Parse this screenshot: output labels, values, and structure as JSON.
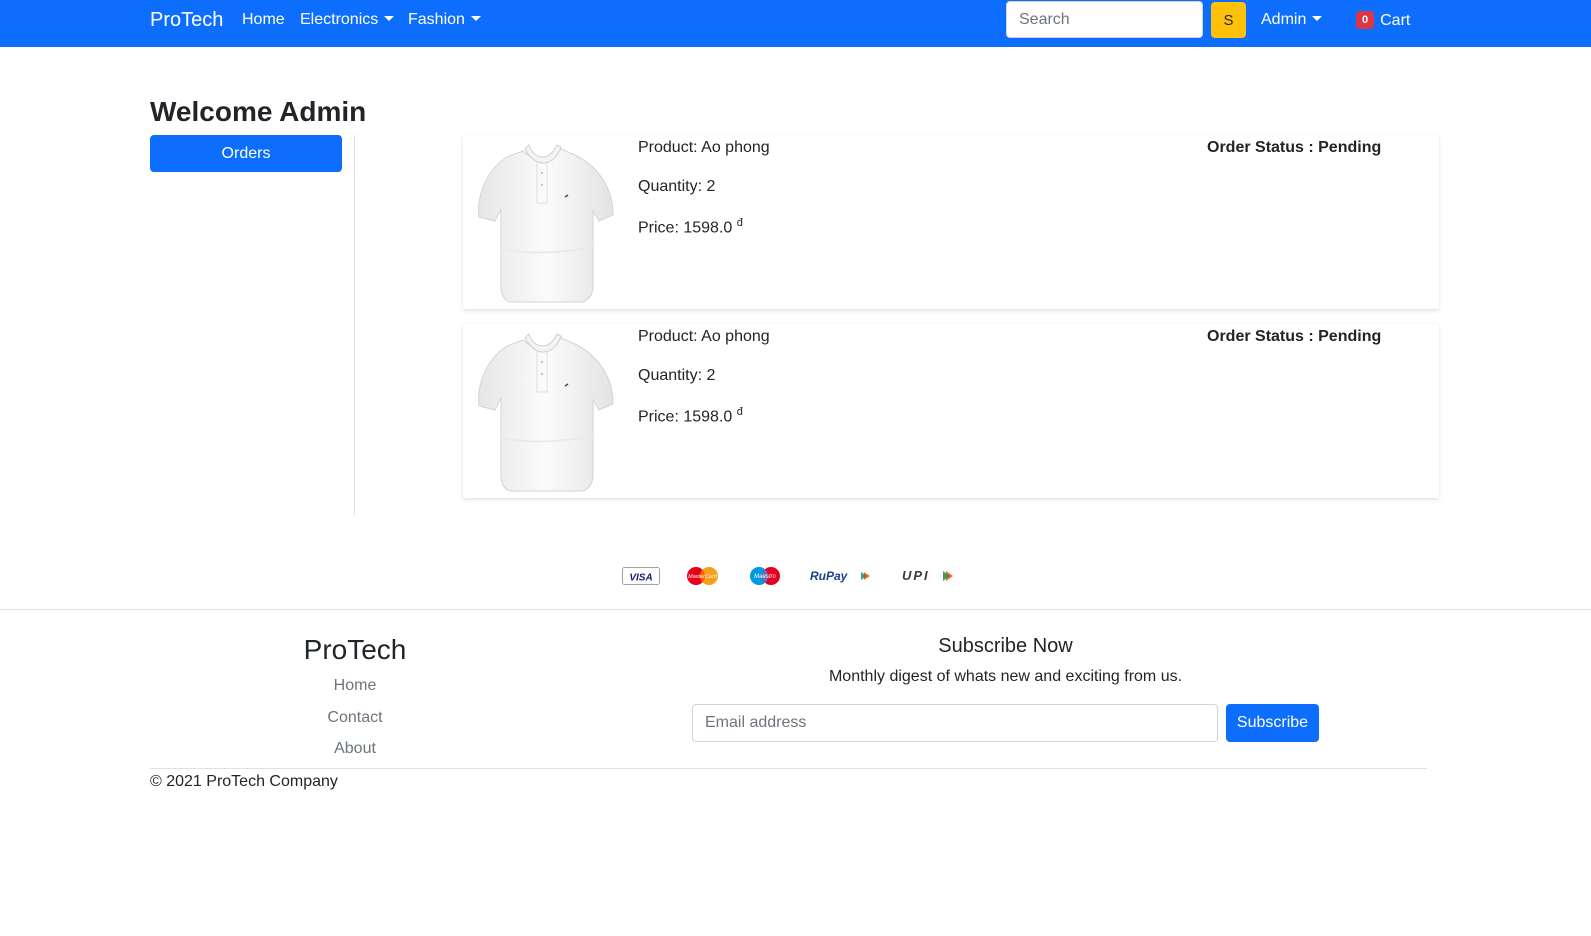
{
  "navbar": {
    "brand": "ProTech",
    "links": [
      "Home",
      "Electronics",
      "Fashion"
    ],
    "search_placeholder": "Search",
    "search_button": "S",
    "account": "Admin",
    "cart_count": "0",
    "cart_label": "Cart"
  },
  "page": {
    "title": "Welcome Admin",
    "sidebar_button": "Orders"
  },
  "orders": [
    {
      "product": "Product: Ao phong",
      "quantity": "Quantity: 2",
      "price": "Price: 1598.0",
      "currency": "đ",
      "status": "Order Status : Pending"
    },
    {
      "product": "Product: Ao phong",
      "quantity": "Quantity: 2",
      "price": "Price: 1598.0",
      "currency": "đ",
      "status": "Order Status : Pending"
    }
  ],
  "payment_methods": [
    "VISA",
    "MasterCard",
    "Maestro",
    "RuPay",
    "UPI"
  ],
  "footer": {
    "brand": "ProTech",
    "links": [
      "Home",
      "Contact",
      "About"
    ],
    "subscribe_title": "Subscribe Now",
    "subscribe_desc": "Monthly digest of whats new and exciting from us.",
    "email_placeholder": "Email address",
    "subscribe_button": "Subscribe",
    "copyright": "© 2021 ProTech Company"
  },
  "colors": {
    "primary": "#0d6efd",
    "warning": "#ffc107",
    "danger": "#dc3545"
  }
}
